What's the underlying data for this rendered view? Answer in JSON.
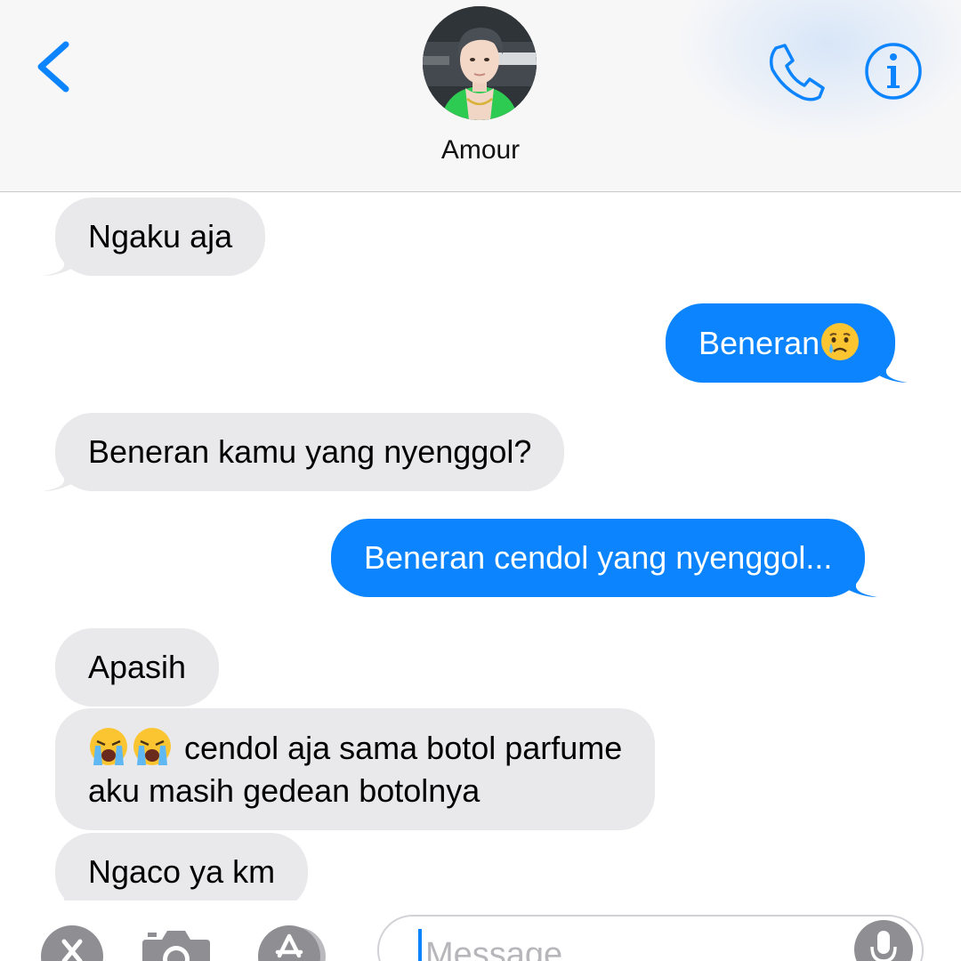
{
  "header": {
    "contact_name": "Amour",
    "back_icon": "chevron-left-icon",
    "call_icon": "phone-icon",
    "info_icon": "info-icon",
    "accent_color": "#0b84fe"
  },
  "messages": [
    {
      "direction": "incoming",
      "text": "Ngaku aja"
    },
    {
      "direction": "outgoing",
      "text": "Beneran",
      "emoji": "crying-face"
    },
    {
      "direction": "incoming",
      "text": "Beneran kamu yang nyenggol?"
    },
    {
      "direction": "outgoing",
      "text": "Beneran cendol yang nyenggol..."
    },
    {
      "direction": "incoming",
      "text": "Apasih"
    },
    {
      "direction": "incoming",
      "emoji": "loudly-crying-face x2",
      "line1": "cendol aja sama botol parfume",
      "line2": "aku masih gedean botolnya"
    },
    {
      "direction": "incoming",
      "text": "Ngaco ya km"
    }
  ],
  "composer": {
    "placeholder": "Message",
    "icons": [
      "close-icon",
      "camera-icon",
      "app-store-icon",
      "microphone-icon"
    ]
  },
  "colors": {
    "incoming_bubble": "#e9e9eb",
    "outgoing_bubble": "#0b84fe",
    "header_background": "#f7f7f8"
  }
}
